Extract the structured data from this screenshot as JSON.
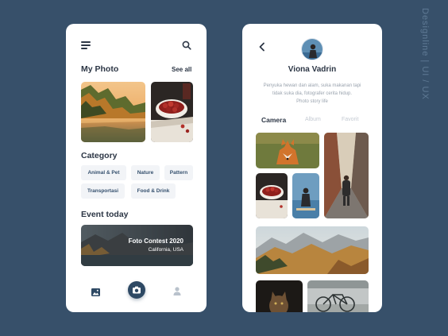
{
  "left_screen": {
    "my_photo_title": "My Photo",
    "see_all_label": "See all",
    "category_title": "Category",
    "categories": [
      "Animal & Pet",
      "Nature",
      "Pattern",
      "Transportasi",
      "Food & Drink"
    ],
    "event_title": "Event today",
    "event_card": {
      "title": "Foto Contest 2020",
      "location": "California, USA"
    },
    "nav": {
      "gallery_icon": "image-icon",
      "camera_icon": "camera-icon",
      "profile_icon": "user-icon"
    }
  },
  "right_screen": {
    "profile_name": "Viona Vadrin",
    "bio_lines": [
      "Penyuka hewan dan alam, suka makanan tapi",
      "tidak suka dia, fotografer cerita hidup.",
      "Photo story life"
    ],
    "tabs": [
      "Camera",
      "Album",
      "Favorit"
    ],
    "active_tab": "Camera"
  },
  "side_label": "Designline  |  UI / UX",
  "colors": {
    "background": "#37506a",
    "card": "#ffffff",
    "accent": "#2e4964",
    "text": "#2c3645",
    "chip_bg": "#f2f4f7"
  }
}
